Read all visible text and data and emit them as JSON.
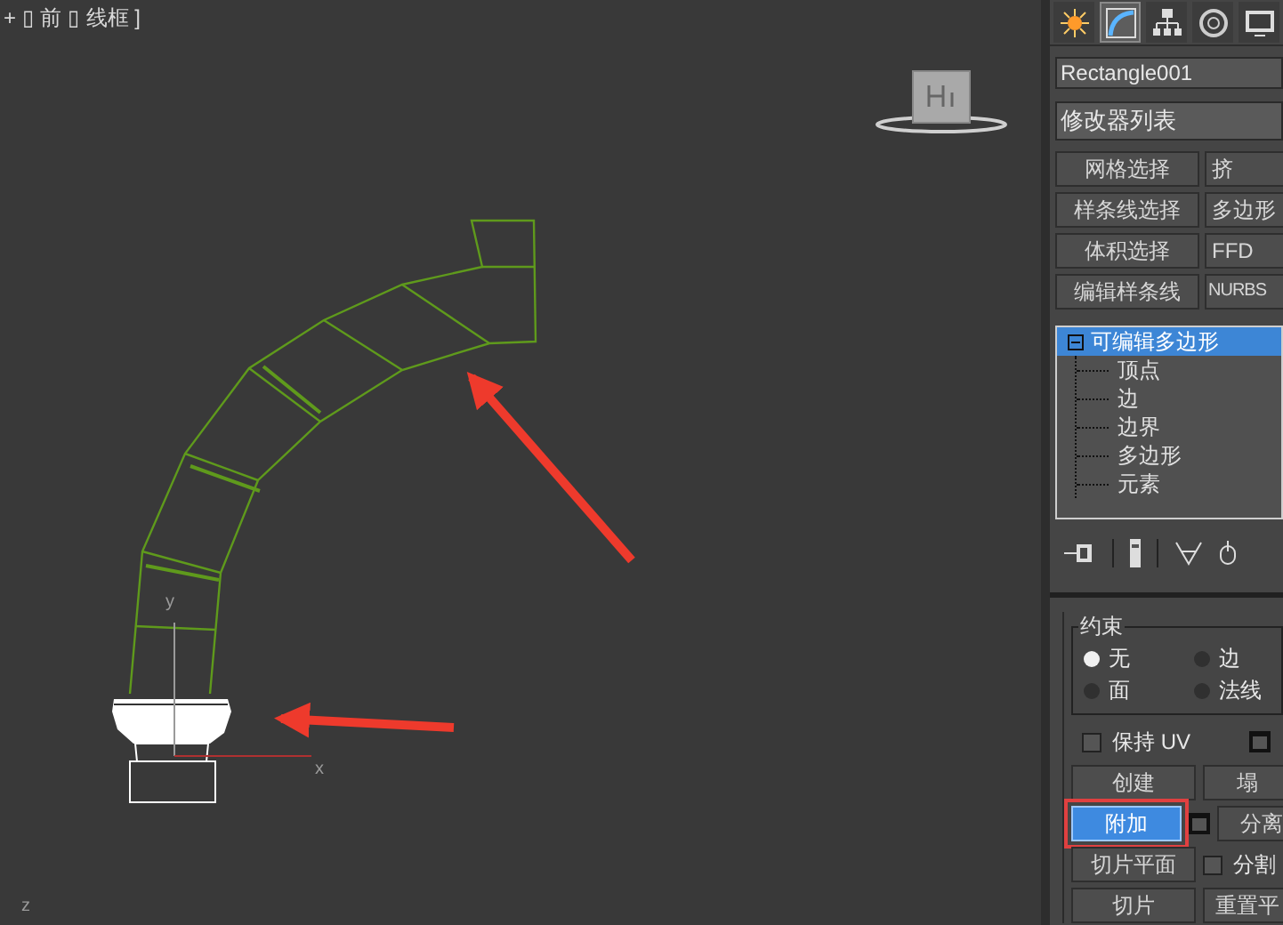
{
  "viewport": {
    "label": "+ ▯ 前 ▯ 线框 ]",
    "axis_labels": [
      "y",
      "x",
      "z"
    ]
  },
  "panel_tabs": [
    {
      "kind": "create",
      "selected": false
    },
    {
      "kind": "modify",
      "selected": true
    },
    {
      "kind": "hierarchy",
      "selected": false
    },
    {
      "kind": "motion",
      "selected": false
    },
    {
      "kind": "display",
      "selected": false
    }
  ],
  "object_name": "Rectangle001",
  "modifier_list": "修改器列表",
  "modifier_buttons": [
    {
      "label": "网格选择"
    },
    {
      "label": "挤"
    },
    {
      "label": "样条线选择"
    },
    {
      "label": "多边形"
    },
    {
      "label": "体积选择"
    },
    {
      "label": "FFD"
    },
    {
      "label": "编辑样条线"
    },
    {
      "label": "NURBS"
    }
  ],
  "stack": {
    "label": "可编辑多边形",
    "selected": true,
    "expanded": true,
    "children": [
      {
        "label": "顶点",
        "selected": false
      },
      {
        "label": "边",
        "selected": false
      },
      {
        "label": "边界",
        "selected": false
      },
      {
        "label": "多边形",
        "selected": false
      },
      {
        "label": "元素",
        "selected": false
      }
    ]
  },
  "constraints": {
    "title": "约束",
    "options": [
      {
        "label": "无",
        "selected": true
      },
      {
        "label": "边",
        "selected": false
      },
      {
        "label": "面",
        "selected": false
      },
      {
        "label": "法线",
        "selected": false
      }
    ]
  },
  "edit_rows": [
    [
      {
        "kind": "checkbox",
        "label": "保持 UV",
        "checked": false
      },
      {
        "kind": "settings"
      }
    ],
    [
      {
        "kind": "button",
        "label": "创建",
        "selected": false
      },
      {
        "kind": "button",
        "label": "塌",
        "selected": false
      }
    ],
    [
      {
        "kind": "button",
        "label": "附加",
        "selected": true,
        "annotated": true
      },
      {
        "kind": "settings"
      },
      {
        "kind": "button",
        "label": "分离",
        "selected": false
      }
    ],
    [
      {
        "kind": "button",
        "label": "切片平面",
        "selected": false
      },
      {
        "kind": "checkbox",
        "label": "分割",
        "checked": false
      }
    ],
    [
      {
        "kind": "button",
        "label": "切片",
        "selected": false
      },
      {
        "kind": "button",
        "label": "重置平",
        "selected": false
      }
    ]
  ]
}
